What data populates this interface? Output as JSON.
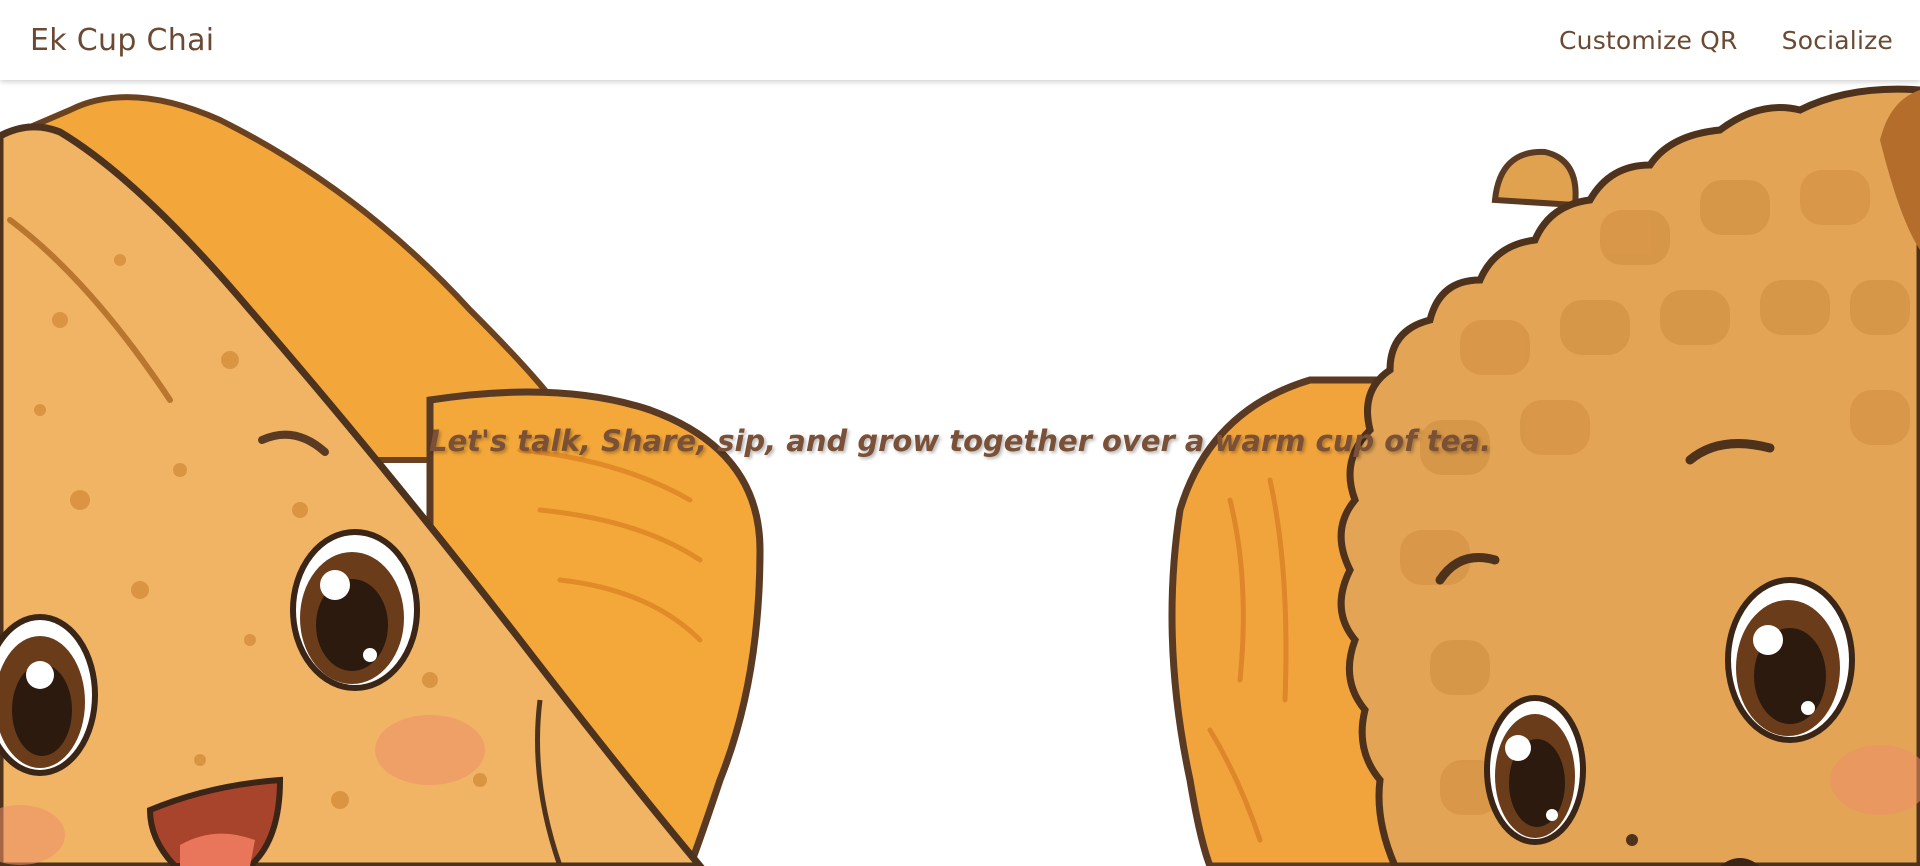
{
  "nav": {
    "brand": "Ek Cup Chai",
    "links": [
      {
        "label": "Customize QR"
      },
      {
        "label": "Socialize"
      }
    ]
  },
  "hero": {
    "tagline": "Let's talk, Share, sip, and grow together over a warm cup of tea."
  },
  "colors": {
    "text_brown": "#6b4a33",
    "tagline_brown": "#7a5036",
    "toast": "#f0b460",
    "biscuit": "#e8a84c",
    "outline": "#5a3a22"
  }
}
